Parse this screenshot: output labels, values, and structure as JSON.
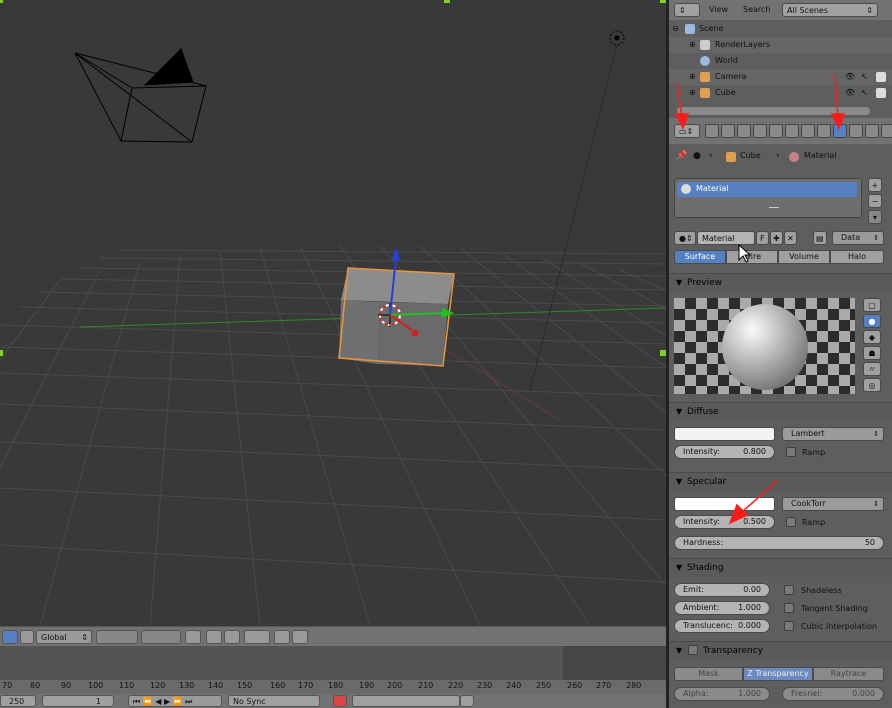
{
  "outliner": {
    "menu_view": "View",
    "menu_search": "Search",
    "scene_selector": "All Scenes",
    "items": [
      {
        "label": "Scene"
      },
      {
        "label": "RenderLayers"
      },
      {
        "label": "World"
      },
      {
        "label": "Camera"
      },
      {
        "label": "Cube"
      }
    ]
  },
  "breadcrumb": {
    "object": "Cube",
    "material": "Material"
  },
  "material_slot": {
    "name": "Material"
  },
  "material_datablock": {
    "name": "Material",
    "fake_user": "F",
    "link": "Data"
  },
  "tabs": [
    "Surface",
    "Wire",
    "Volume",
    "Halo"
  ],
  "active_tab": "Surface",
  "panels": {
    "preview": "Preview",
    "diffuse": {
      "title": "Diffuse",
      "shader": "Lambert",
      "intensity_label": "Intensity:",
      "intensity_value": "0.800",
      "ramp": "Ramp",
      "color": "#f2f2f2"
    },
    "specular": {
      "title": "Specular",
      "shader": "CookTorr",
      "intensity_label": "Intensity:",
      "intensity_value": "0.500",
      "ramp": "Ramp",
      "hardness_label": "Hardness:",
      "hardness_value": "50",
      "color": "#ffffff"
    },
    "shading": {
      "title": "Shading",
      "emit_label": "Emit:",
      "emit_value": "0.00",
      "ambient_label": "Ambient:",
      "ambient_value": "1.000",
      "translucency_label": "Translucenc:",
      "translucency_value": "0.000",
      "shadeless": "Shadeless",
      "tangent_shading": "Tangent Shading",
      "cubic_interpolation": "Cubic Interpolation"
    },
    "transparency": {
      "title": "Transparency",
      "modes": [
        "Mask",
        "Z Transparency",
        "Raytrace"
      ],
      "active_mode": "Z Transparency",
      "alpha_label": "Alpha:",
      "alpha_value": "1.000",
      "fresnel_label": "Fresnel:",
      "fresnel_value": "0.000"
    }
  },
  "viewport_header": {
    "orientation": "Global"
  },
  "timeline": {
    "ruler": [
      "70",
      "80",
      "90",
      "100",
      "110",
      "120",
      "130",
      "140",
      "150",
      "160",
      "170",
      "180",
      "190",
      "200",
      "210",
      "220",
      "230",
      "240",
      "250",
      "260",
      "270",
      "280"
    ],
    "end_frame": "250",
    "current_frame": "1",
    "sync": "No Sync"
  },
  "colors": {
    "accent": "#5680c2",
    "selected_outline": "#e8963c",
    "annotation": "#ff1a1a",
    "axis_x": "#d42020",
    "axis_y": "#20c020",
    "axis_z": "#2040e0"
  }
}
